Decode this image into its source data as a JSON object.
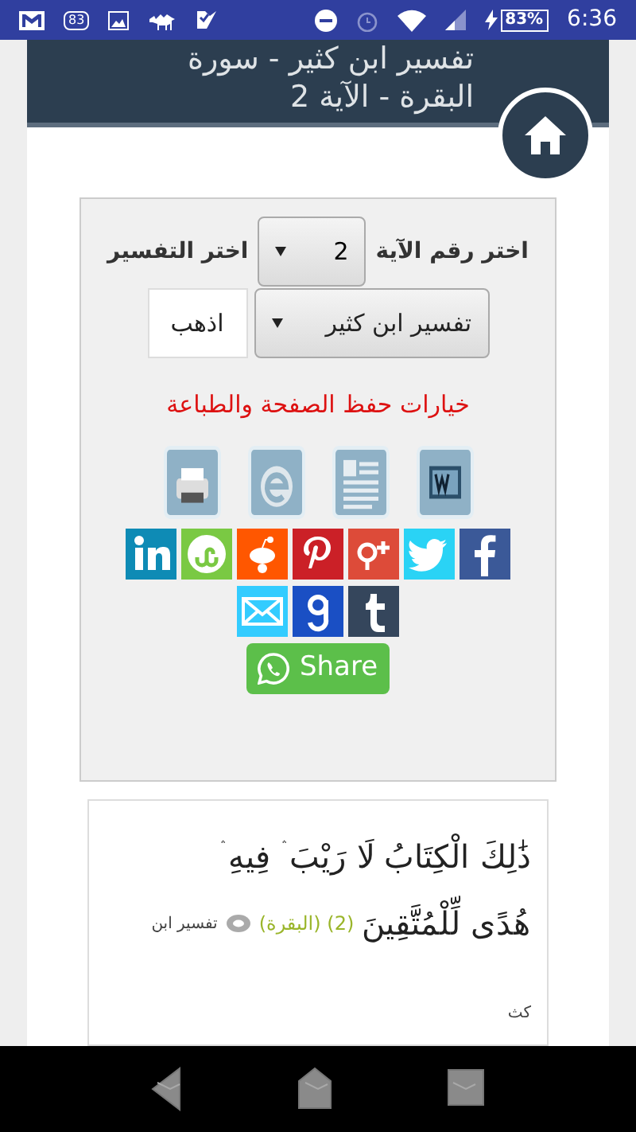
{
  "status_bar": {
    "notification_count": "83",
    "battery": "83%",
    "time": "6:36"
  },
  "header": {
    "title_lines": [
      "تفسير ابن كثير - سورة",
      "البقرة - الآية 2"
    ]
  },
  "form": {
    "verse_label": "اختر رقم الآية",
    "verse_value": "2",
    "tafsir_label": "اختر التفسير",
    "tafsir_value": "تفسير ابن كثير",
    "go_button": "اذهب"
  },
  "save_options": {
    "title": "خيارات حفظ الصفحة والطباعة",
    "tools": [
      {
        "kind": "print"
      },
      {
        "kind": "e"
      },
      {
        "kind": "document"
      },
      {
        "kind": "word"
      }
    ],
    "social": [
      {
        "kind": "linkedin",
        "color": "#0e8bb5"
      },
      {
        "kind": "stumbleupon",
        "color": "#7ac943"
      },
      {
        "kind": "reddit",
        "color": "#ff5700"
      },
      {
        "kind": "pinterest",
        "color": "#cb2027"
      },
      {
        "kind": "googleplus",
        "color": "#dd4b39"
      },
      {
        "kind": "twitter",
        "color": "#2ad3f5"
      },
      {
        "kind": "facebook",
        "color": "#3b5998"
      }
    ],
    "social_row2": [
      {
        "kind": "email",
        "color": "#33ccff"
      },
      {
        "kind": "google",
        "color": "#1a4fc4"
      },
      {
        "kind": "tumblr",
        "color": "#35465c"
      }
    ],
    "share_button": "Share"
  },
  "verse": {
    "lines": [
      "ذَٰلِكَ الْكِتَابُ لَا رَيْبَ ۛ فِيهِ ۛ",
      "هُدًى لِّلْمُتَّقِينَ"
    ],
    "number": "(2)",
    "surah": "(البقرة)",
    "tafsir_link": "تفسير ابن",
    "tafsir_link_rest": "كث"
  }
}
